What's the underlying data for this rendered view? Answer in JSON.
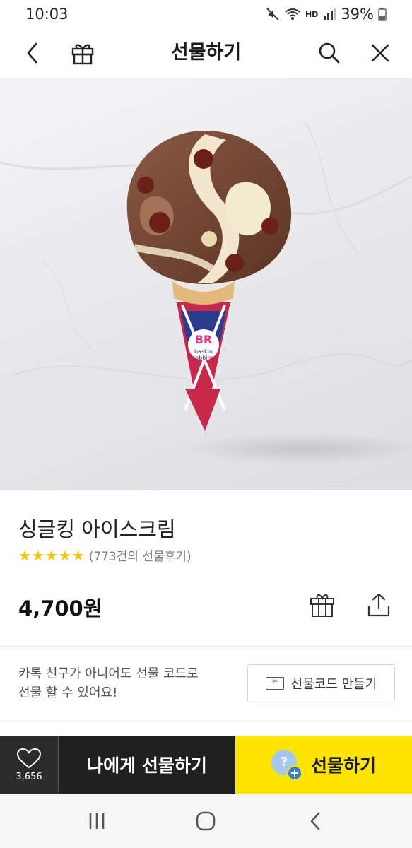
{
  "status_bar": {
    "time": "10:03",
    "hd_label": "HD",
    "battery": "39%"
  },
  "header": {
    "title": "선물하기",
    "back_icon": "chevron-left-icon",
    "gift_icon": "gift-icon",
    "search_icon": "search-icon",
    "close_icon": "close-icon"
  },
  "hero": {
    "logo_text": "BR",
    "brand_line1": "baskin",
    "brand_line2": "robbins"
  },
  "product": {
    "name": "싱글킹 아이스크림",
    "rating_stars": 5,
    "review_text": "(773건의 선물후기)",
    "price": "4,700원",
    "star_color": "#f5c400"
  },
  "gift_code": {
    "text_line1": "카톡 친구가 아니어도 선물 코드로",
    "text_line2": "선물 할 수 있어요!",
    "button_label": "선물코드 만들기",
    "ticket_mark": "**"
  },
  "bottom_bar": {
    "like_count": "3,656",
    "self_gift_label": "나에게 선물하기",
    "gift_label": "선물하기",
    "gift_badge_q": "?",
    "gift_badge_plus": "+",
    "accent_color": "#fee500"
  },
  "nav": {
    "recent_icon": "recent-apps-icon",
    "home_icon": "home-icon",
    "back_icon": "back-icon"
  }
}
